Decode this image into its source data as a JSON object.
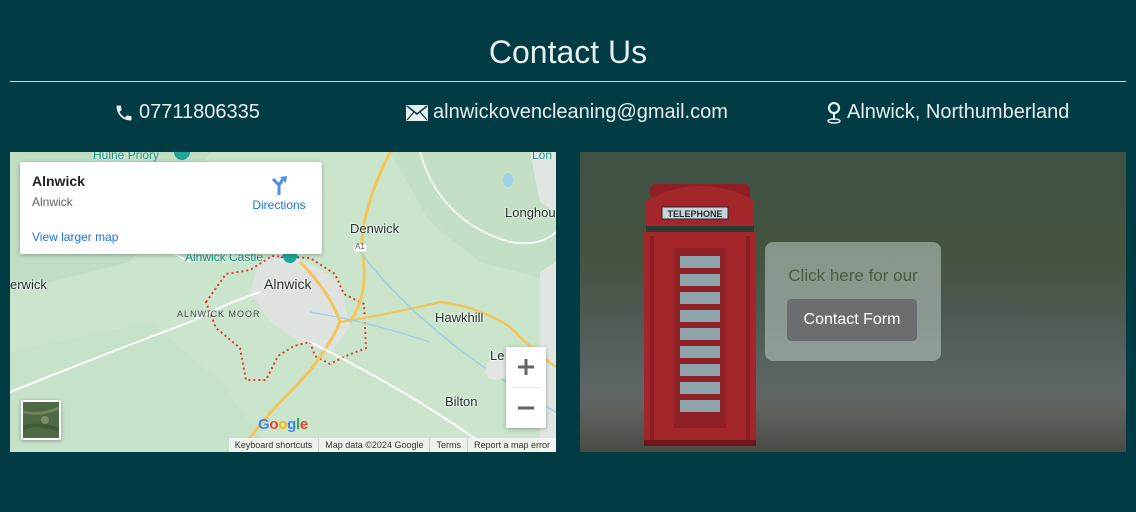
{
  "page": {
    "title": "Contact Us"
  },
  "contact": {
    "phone": "07711806335",
    "email": "alnwickovencleaning@gmail.com",
    "location": "Alnwick, Northumberland"
  },
  "map": {
    "info_card": {
      "name": "Alnwick",
      "subtitle": "Alnwick",
      "directions_label": "Directions",
      "larger_map_link": "View larger map"
    },
    "places": {
      "hulne_priory": "Hulne Priory",
      "denwick": "Denwick",
      "longhoughton": "Longhou",
      "alnwick_castle": "Alnwick Castle",
      "alnwick": "Alnwick",
      "erwick": "erwick",
      "alnwick_moor": "ALNWICK MOOR",
      "hawkhill": "Hawkhill",
      "lesbury": "Le",
      "bilton": "Bilton",
      "a1_shield": "A1",
      "lon": "Lon"
    },
    "zoom_in": "+",
    "zoom_out": "−",
    "logo": {
      "g1": "G",
      "o1": "o",
      "o2": "o",
      "g2": "g",
      "l": "l",
      "e": "e"
    },
    "attribution": [
      "Keyboard shortcuts",
      "Map data ©2024 Google",
      "Terms",
      "Report a map error"
    ]
  },
  "photo": {
    "booth_sign": "TELEPHONE",
    "cta_text": "Click here for our",
    "cta_button": "Contact Form"
  },
  "colors": {
    "background": "#013c44",
    "booth_red": "#a3262b",
    "link_blue": "#1a73e8"
  }
}
